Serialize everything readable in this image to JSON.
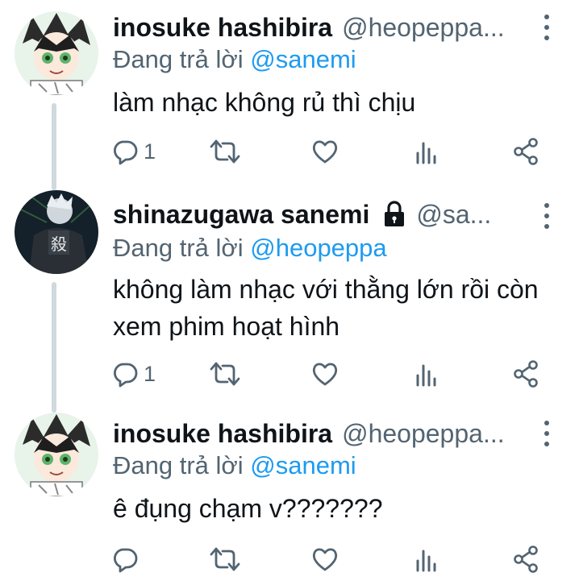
{
  "tweets": [
    {
      "display_name": "inosuke hashibira",
      "handle": "@heopeppa...",
      "reply_prefix": "Đang trả lời",
      "reply_to": "@sanemi",
      "text": "làm nhạc không rủ thì chịu",
      "reply_count": "1",
      "locked": false,
      "avatar": "inosuke-avatar"
    },
    {
      "display_name": "shinazugawa sanemi",
      "handle": "@sa...",
      "reply_prefix": "Đang trả lời",
      "reply_to": "@heopeppa",
      "text": "không làm nhạc với thằng lớn rồi còn xem phim hoạt hình",
      "reply_count": "1",
      "locked": true,
      "avatar": "sanemi-avatar"
    },
    {
      "display_name": "inosuke hashibira",
      "handle": "@heopeppa...",
      "reply_prefix": "Đang trả lời",
      "reply_to": "@sanemi",
      "text": "ê đụng chạm v???????",
      "reply_count": "",
      "locked": false,
      "avatar": "inosuke-avatar"
    }
  ],
  "icons": [
    "reply-icon",
    "retweet-icon",
    "like-icon",
    "analytics-icon",
    "share-icon",
    "more-icon",
    "lock-icon"
  ],
  "colors": {
    "text": "#0f1419",
    "secondary": "#536471",
    "mention": "#1d9bf0",
    "thread_line": "#cfd9de",
    "background": "#ffffff"
  }
}
